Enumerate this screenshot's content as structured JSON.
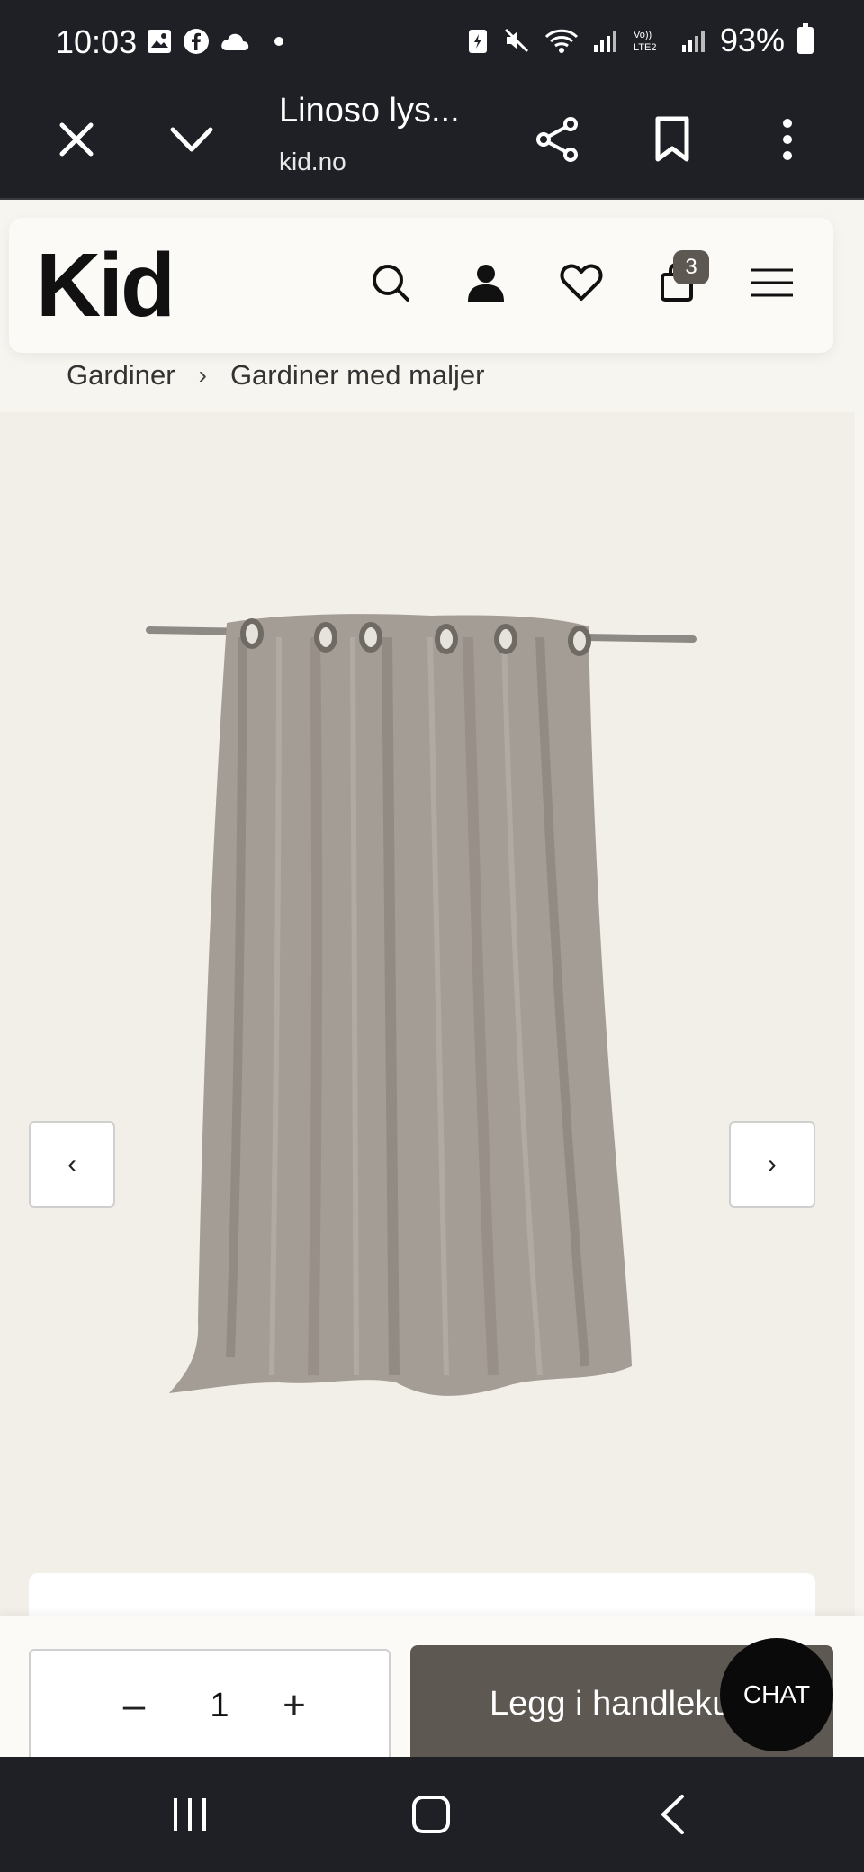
{
  "status_bar": {
    "time": "10:03",
    "battery": "93%"
  },
  "browser": {
    "title": "Linoso lys...",
    "domain": "kid.no"
  },
  "site": {
    "logo": "Kid",
    "cart_count": "3"
  },
  "breadcrumb": {
    "items": [
      "Gardiner",
      "Gardiner med maljer"
    ],
    "separator": "›"
  },
  "gallery": {
    "prev_label": "‹",
    "next_label": "›"
  },
  "purchase": {
    "quantity": "1",
    "minus_label": "–",
    "plus_label": "+",
    "add_to_cart": "Legg i handlekurv"
  },
  "chat": {
    "label": "CHAT"
  },
  "colors": {
    "accent": "#5e5853",
    "page_bg": "#f7f5f0",
    "chrome": "#1f2026"
  }
}
